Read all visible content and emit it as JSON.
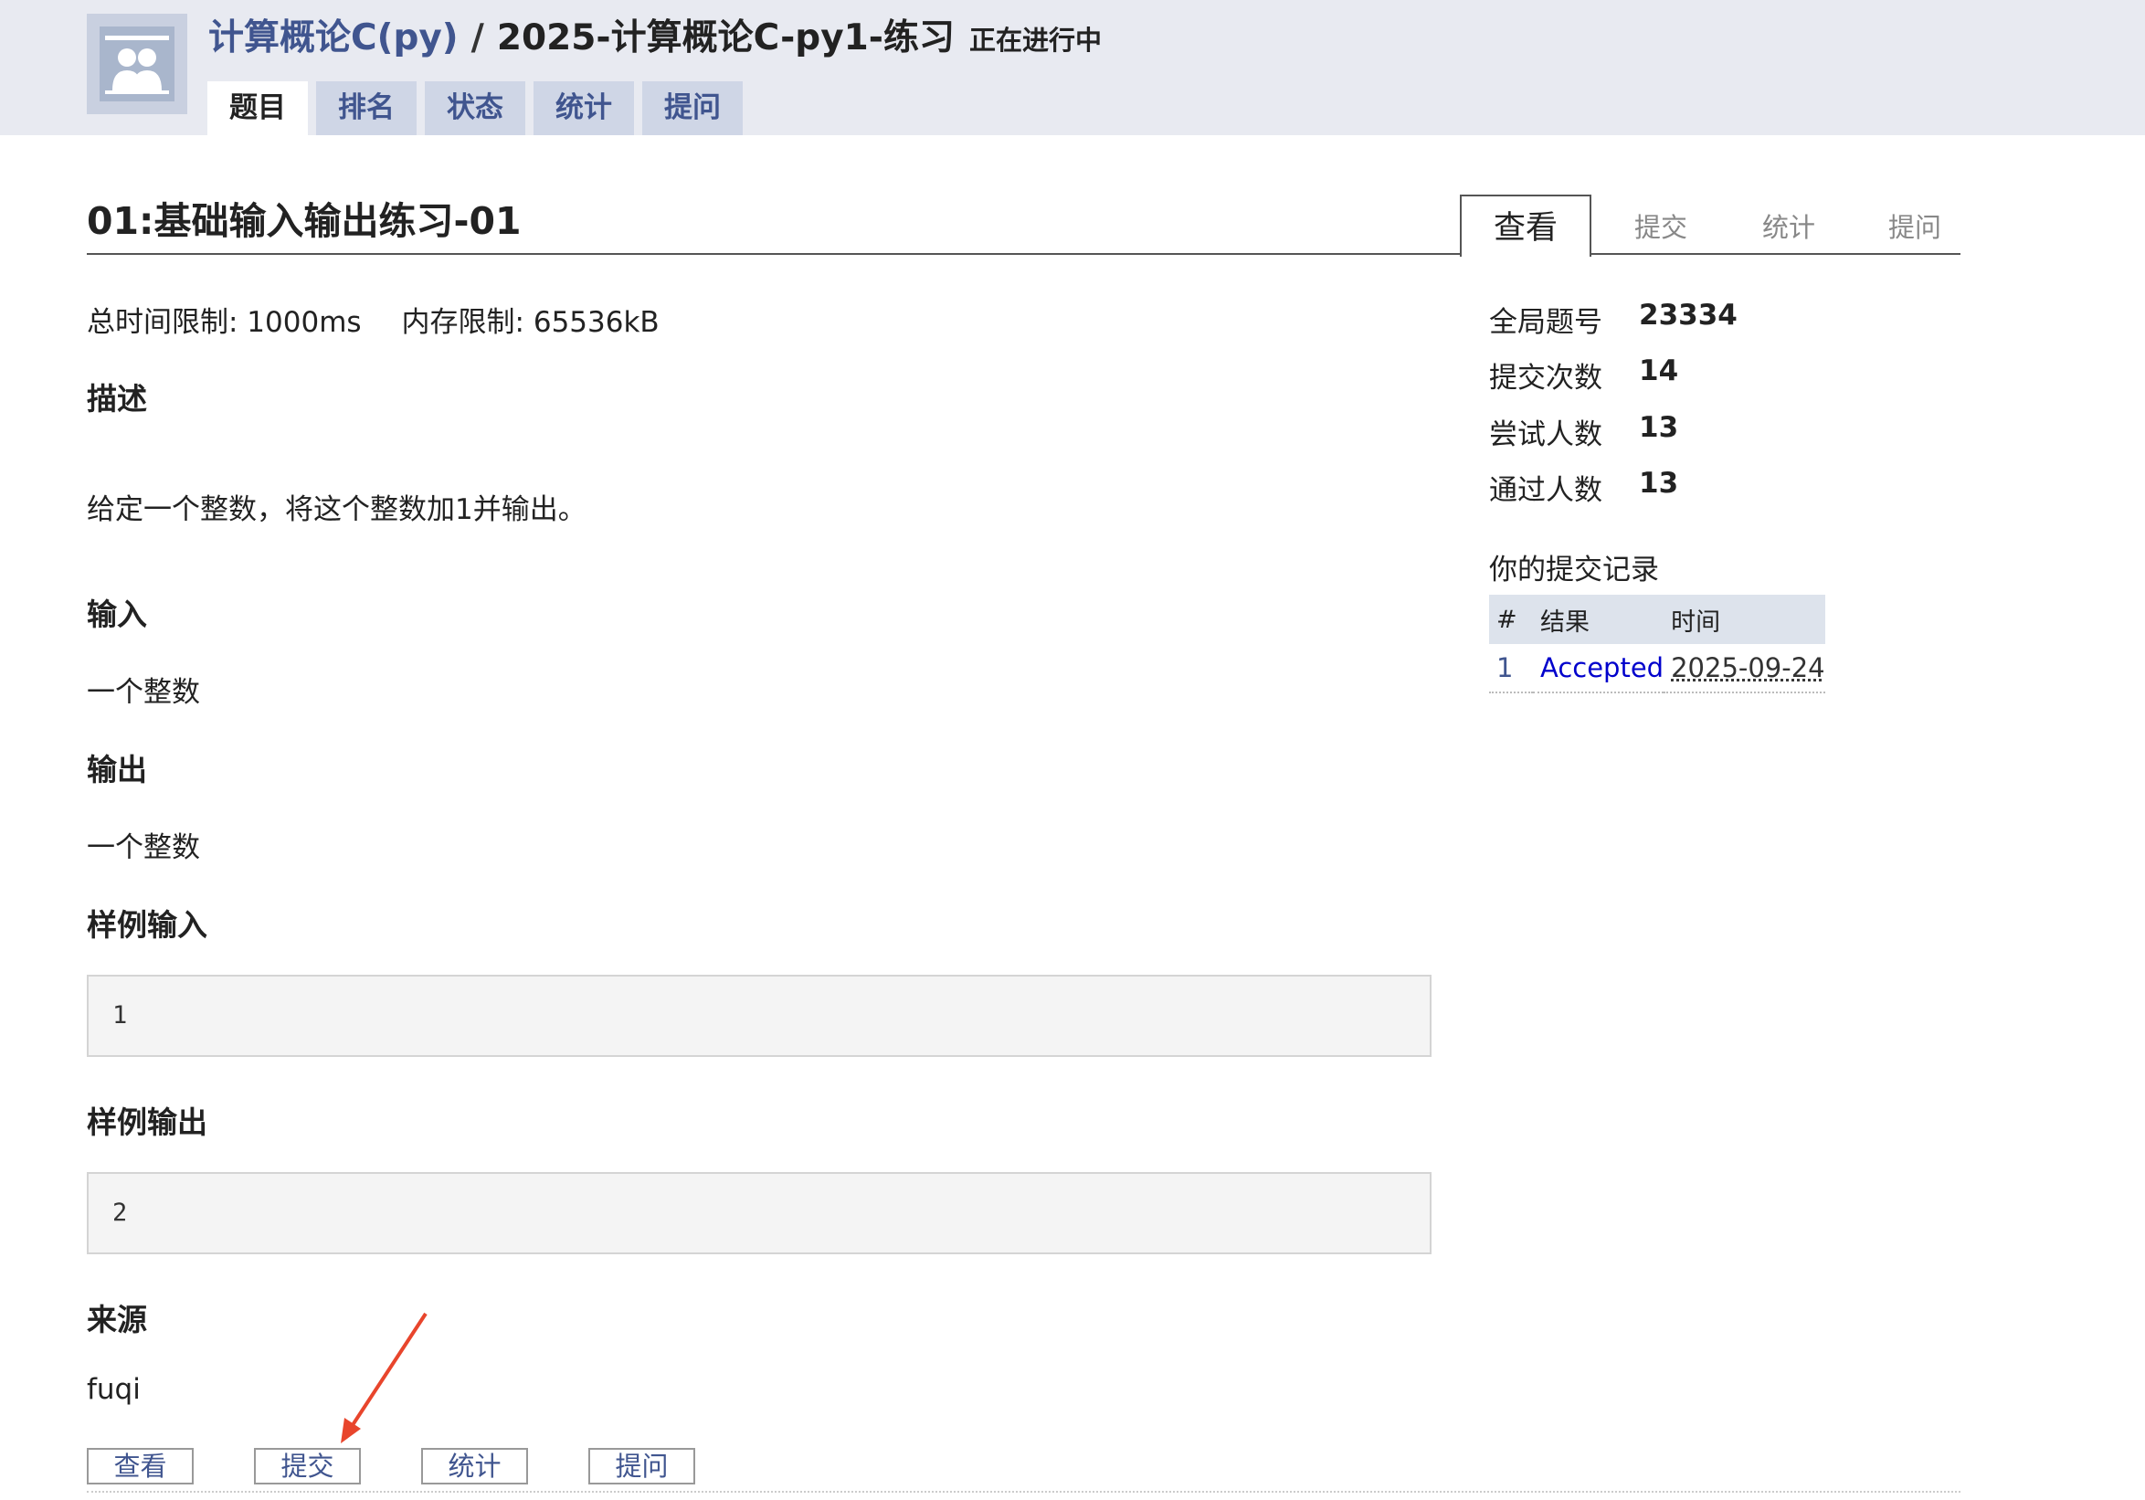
{
  "header": {
    "course": "计算概论C(py)",
    "separator": "/",
    "contest": "2025-计算概论C-py1-练习",
    "status": "正在进行中",
    "tabs": [
      {
        "label": "题目",
        "active": true
      },
      {
        "label": "排名",
        "active": false
      },
      {
        "label": "状态",
        "active": false
      },
      {
        "label": "统计",
        "active": false
      },
      {
        "label": "提问",
        "active": false
      }
    ]
  },
  "problem": {
    "title": "01:基础输入输出练习-01",
    "time_limit": "总时间限制: 1000ms",
    "memory_limit": "内存限制: 65536kB",
    "description_heading": "描述",
    "description": "给定一个整数，将这个整数加1并输出。",
    "input_heading": "输入",
    "input": "一个整数",
    "output_heading": "输出",
    "output": "一个整数",
    "sample_input_heading": "样例输入",
    "sample_input": "1",
    "sample_output_heading": "样例输出",
    "sample_output": "2",
    "source_heading": "来源",
    "source": "fuqi"
  },
  "right_tabs": [
    {
      "label": "查看",
      "active": true
    },
    {
      "label": "提交",
      "active": false
    },
    {
      "label": "统计",
      "active": false
    },
    {
      "label": "提问",
      "active": false
    }
  ],
  "stats": [
    {
      "label": "全局题号",
      "value": "23334"
    },
    {
      "label": "提交次数",
      "value": "14"
    },
    {
      "label": "尝试人数",
      "value": "13"
    },
    {
      "label": "通过人数",
      "value": "13"
    }
  ],
  "submissions": {
    "title": "你的提交记录",
    "columns": [
      "#",
      "结果",
      "时间"
    ],
    "rows": [
      {
        "num": "1",
        "result": "Accepted",
        "time": "2025-09-24"
      }
    ]
  },
  "bottom_buttons": [
    "查看",
    "提交",
    "统计",
    "提问"
  ],
  "colors": {
    "link": "#40558f",
    "accepted": "#0000cc",
    "header_bg": "#e8eaf1",
    "annotation_arrow": "#e8452c"
  },
  "icons": {
    "logo": "group-users-icon",
    "annotation": "red-arrow-icon"
  }
}
